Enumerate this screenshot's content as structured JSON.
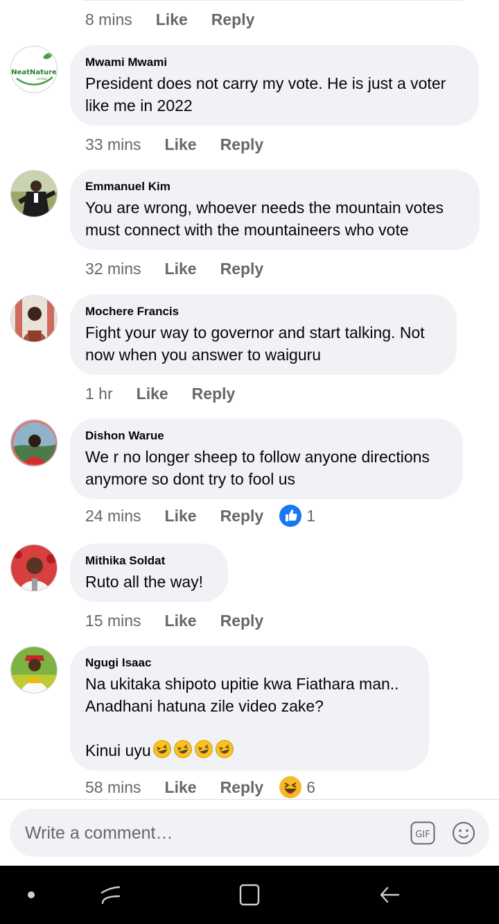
{
  "first_comment_meta": {
    "time": "8 mins",
    "like": "Like",
    "reply": "Reply"
  },
  "comments": [
    {
      "author": "Mwami Mwami",
      "text": "President does not carry my vote. He is just a voter like me in 2022",
      "time": "33 mins",
      "like": "Like",
      "reply": "Reply",
      "avatar_logo": "NeatNature",
      "avatar_logo_sub": "Limited"
    },
    {
      "author": "Emmanuel Kim",
      "text": "You are wrong, whoever needs the mountain votes must connect with the mountaineers who vote",
      "time": "32 mins",
      "like": "Like",
      "reply": "Reply"
    },
    {
      "author": "Mochere Francis",
      "text": "Fight your way to governor and start talking. Not now when you answer to waiguru",
      "time": "1 hr",
      "like": "Like",
      "reply": "Reply"
    },
    {
      "author": "Dishon Warue",
      "text": "We r no longer sheep to follow anyone directions anymore so dont try to fool us",
      "time": "24 mins",
      "like": "Like",
      "reply": "Reply",
      "reaction": {
        "icon": "like-thumb-icon",
        "count": "1"
      }
    },
    {
      "author": "Mithika Soldat",
      "text": "Ruto all the way!",
      "time": "15 mins",
      "like": "Like",
      "reply": "Reply"
    },
    {
      "author": "Ngugi Isaac",
      "text": "Na ukitaka shipoto upitie kwa Fiathara man.. Anadhani hatuna zile video zake?\n\n",
      "text_tail": "Kinui uyu",
      "time": "58 mins",
      "like": "Like",
      "reply": "Reply",
      "reaction": {
        "icon": "haha-icon",
        "count": "6"
      }
    }
  ],
  "composer": {
    "placeholder": "Write a comment…",
    "gif_label": "GIF"
  },
  "colors": {
    "bubble": "#f0f2f5",
    "meta_text": "#65676b",
    "like_blue": "#1877f2",
    "haha_yellow": "#f7b928",
    "nav_bar": "#000000"
  }
}
